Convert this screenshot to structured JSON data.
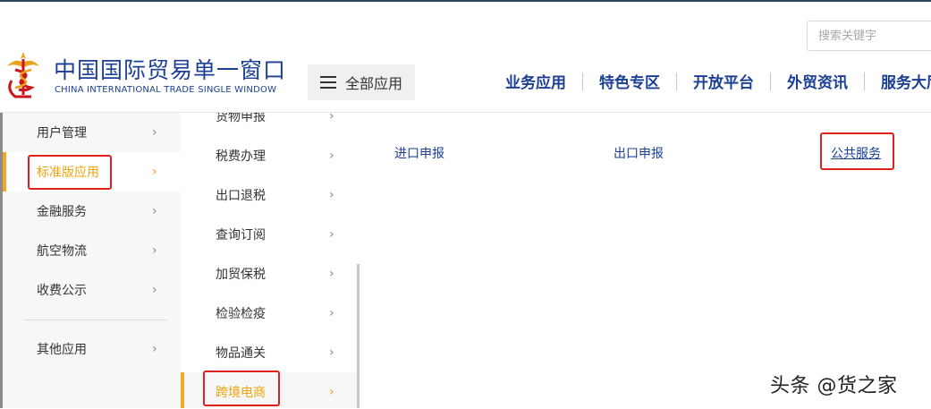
{
  "header": {
    "site_title_cn": "中国国际贸易单一窗口",
    "site_title_en": "CHINA INTERNATIONAL TRADE SINGLE WINDOW",
    "search_placeholder": "搜索关键字",
    "all_apps_label": "全部应用",
    "nav": [
      "业务应用",
      "特色专区",
      "开放平台",
      "外贸资讯",
      "服务大厅"
    ]
  },
  "menu": {
    "level1": [
      {
        "label": "用户管理",
        "active": false
      },
      {
        "label": "标准版应用",
        "active": true
      },
      {
        "label": "金融服务",
        "active": false
      },
      {
        "label": "航空物流",
        "active": false
      },
      {
        "label": "收费公示",
        "active": false
      },
      {
        "label": "其他应用",
        "active": false
      }
    ],
    "level2": [
      {
        "label": "货物申报",
        "active": false
      },
      {
        "label": "税费办理",
        "active": false
      },
      {
        "label": "出口退税",
        "active": false
      },
      {
        "label": "查询订阅",
        "active": false
      },
      {
        "label": "加贸保税",
        "active": false
      },
      {
        "label": "检验检疫",
        "active": false
      },
      {
        "label": "物品通关",
        "active": false
      },
      {
        "label": "跨境电商",
        "active": true
      }
    ],
    "level3": [
      "进口申报",
      "出口申报",
      "公共服务"
    ],
    "arrow_glyph": "›"
  },
  "watermark": "头条 @货之家",
  "colors": {
    "brand_blue": "#1c3f94",
    "active_orange": "#f0a30a",
    "highlight_red": "#e0201b"
  }
}
